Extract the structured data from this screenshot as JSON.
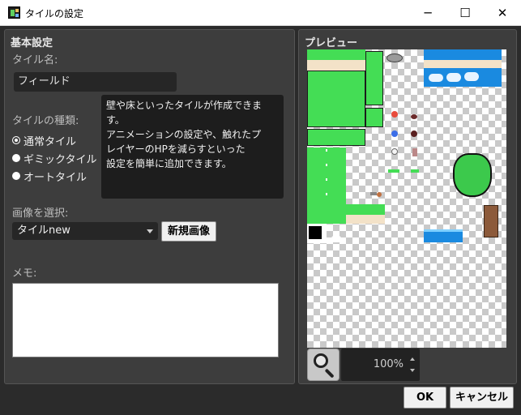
{
  "window": {
    "title": "タイルの設定",
    "min_glyph": "─",
    "max_glyph": "☐",
    "close_glyph": "✕"
  },
  "basic": {
    "heading": "基本設定",
    "tile_name_label": "タイル名:",
    "tile_name_value": "フィールド",
    "tile_type_label": "タイルの種類:",
    "tile_types": [
      {
        "label": "通常タイル",
        "checked": true
      },
      {
        "label": "ギミックタイル",
        "checked": false
      },
      {
        "label": "オートタイル",
        "checked": false
      }
    ],
    "description_lines": [
      "壁や床といったタイルが作成できます。",
      "アニメーションの設定や、触れたプ",
      "レイヤーのHPを減らすといった",
      "設定を簡単に追加できます。"
    ],
    "image_select_label": "画像を選択:",
    "image_selected": "タイルnew",
    "new_image_button": "新規画像",
    "memo_label": "メモ:",
    "memo_value": ""
  },
  "preview": {
    "heading": "プレビュー",
    "zoom_value": "100%"
  },
  "footer": {
    "ok_label": "OK",
    "cancel_label": "キャンセル"
  },
  "colors": {
    "grass": "#44dd55",
    "sand": "#f3e2c8",
    "water": "#1a8ae0",
    "tree": "#3cc94c",
    "trunk": "#8c5a3a"
  }
}
